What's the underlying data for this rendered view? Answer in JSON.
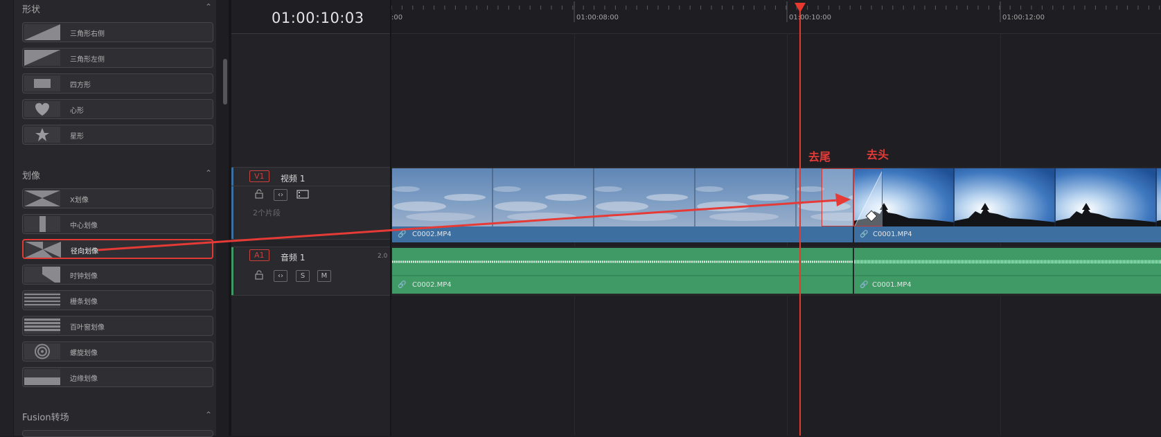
{
  "effects_panel": {
    "sections": [
      {
        "title": "形状",
        "items": [
          "三角形右侧",
          "三角形左侧",
          "四方形",
          "心形",
          "星形"
        ]
      },
      {
        "title": "划像",
        "items": [
          "X划像",
          "中心划像",
          "径向划像",
          "时钟划像",
          "栅条划像",
          "百叶窗划像",
          "螺旋划像",
          "边缘划像"
        ]
      },
      {
        "title": "Fusion转场",
        "items": []
      }
    ],
    "selected_item": "径向划像"
  },
  "timeline": {
    "timecode": "01:00:10:03",
    "ruler_labels": [
      ":00",
      "01:00:08:00",
      "01:00:10:00",
      "01:00:12:00"
    ],
    "video_track": {
      "id": "V1",
      "name": "视频 1",
      "clip_count": "2个片段"
    },
    "audio_track": {
      "id": "A1",
      "name": "音频 1",
      "channels": "2.0",
      "solo": "S",
      "mute": "M"
    },
    "clips": {
      "first": "C0002.MP4",
      "second": "C0001.MP4"
    }
  },
  "annotations": {
    "tail": "去尾",
    "head": "去头"
  },
  "colors": {
    "accent_red": "#e53a36",
    "video_clip": "#3d6fa0",
    "audio_clip": "#3f9a66",
    "playhead": "#e8392e"
  }
}
